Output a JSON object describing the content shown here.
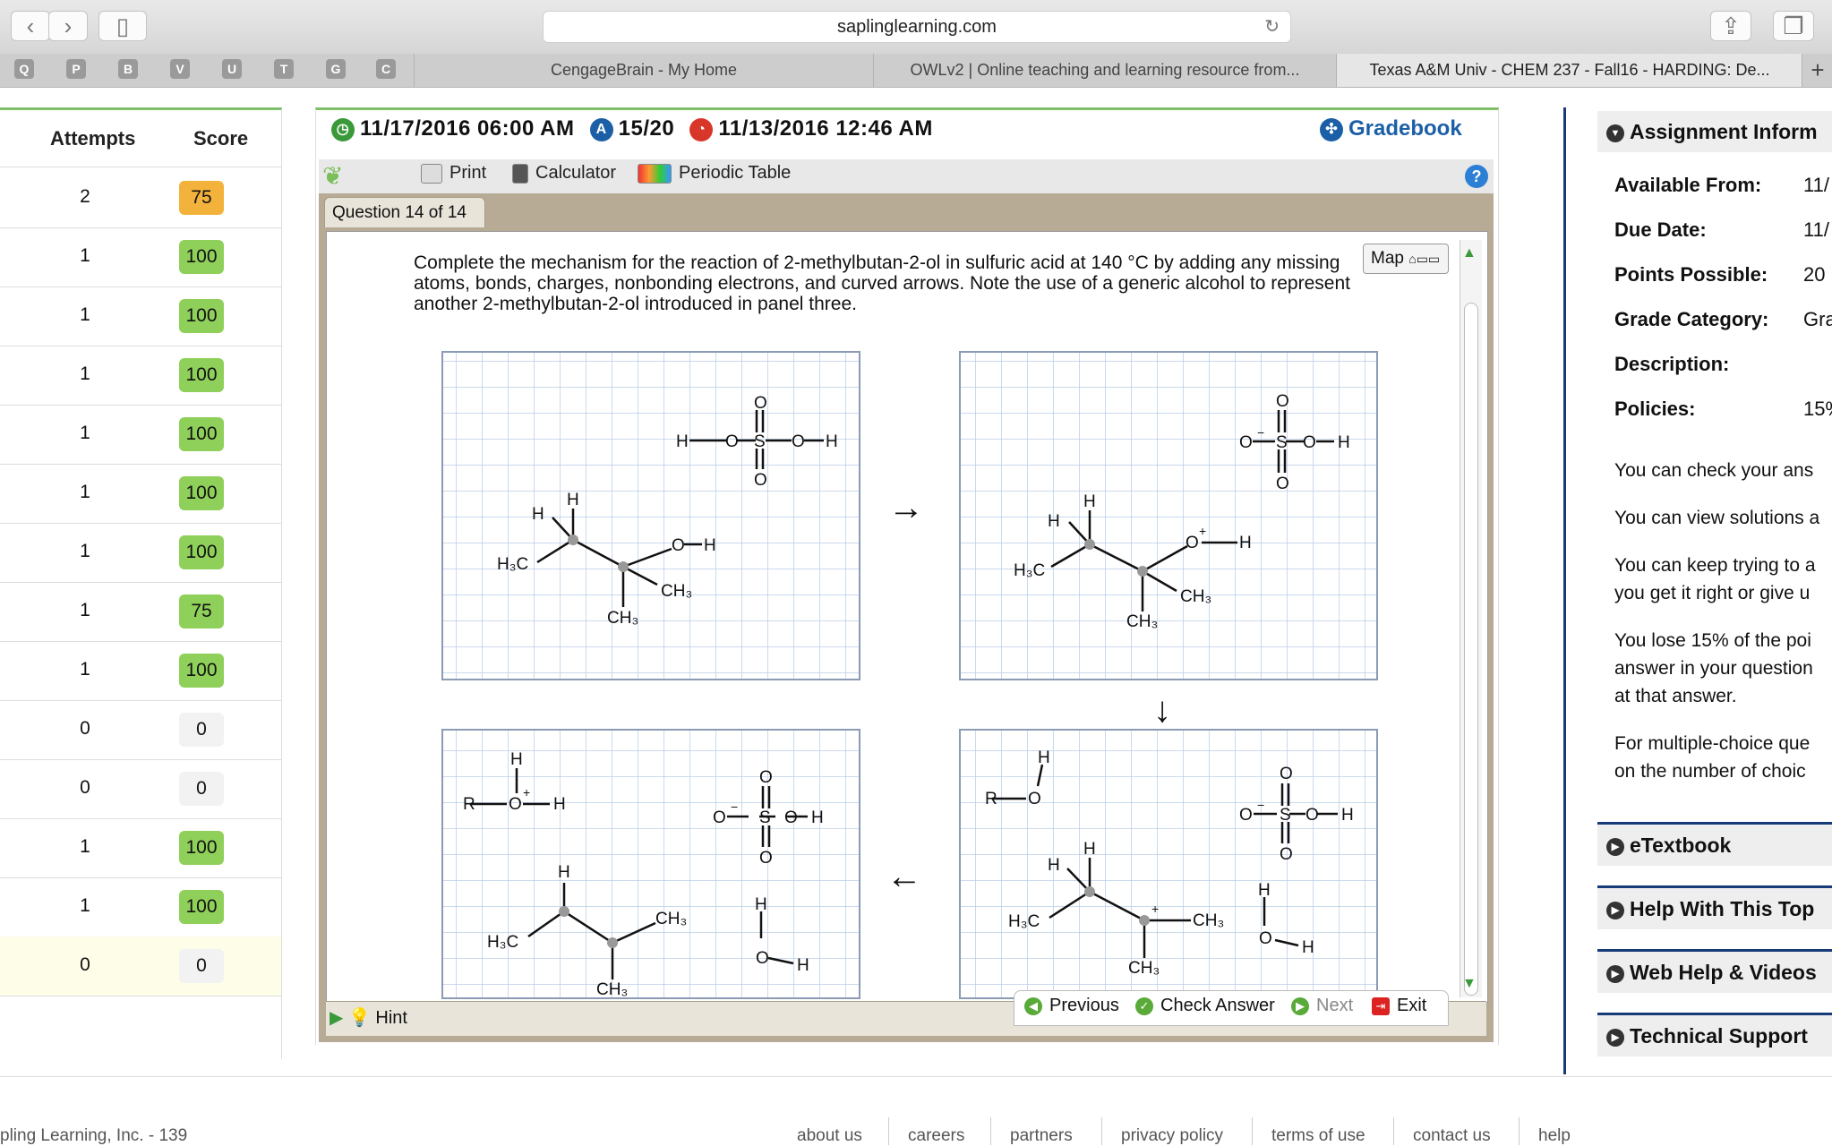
{
  "browser": {
    "url": "saplinglearning.com",
    "bookmarks": [
      "Q",
      "P",
      "B",
      "V",
      "U",
      "T",
      "G",
      "C"
    ],
    "tabs": [
      {
        "label": "CengageBrain - My Home"
      },
      {
        "label": "OWLv2 | Online teaching and learning resource from..."
      },
      {
        "label": "Texas A&M Univ - CHEM 237 - Fall16 - HARDING: De..."
      }
    ],
    "new_tab": "+"
  },
  "scores": {
    "headers": {
      "attempts": "Attempts",
      "score": "Score"
    },
    "rows": [
      {
        "attempts": "2",
        "score": "75",
        "color": "#f3b23b"
      },
      {
        "attempts": "1",
        "score": "100",
        "color": "#8fd05a"
      },
      {
        "attempts": "1",
        "score": "100",
        "color": "#8fd05a"
      },
      {
        "attempts": "1",
        "score": "100",
        "color": "#8fd05a"
      },
      {
        "attempts": "1",
        "score": "100",
        "color": "#8fd05a"
      },
      {
        "attempts": "1",
        "score": "100",
        "color": "#8fd05a"
      },
      {
        "attempts": "1",
        "score": "100",
        "color": "#8fd05a"
      },
      {
        "attempts": "1",
        "score": "75",
        "color": "#8fd05a"
      },
      {
        "attempts": "1",
        "score": "100",
        "color": "#8fd05a"
      },
      {
        "attempts": "0",
        "score": "0",
        "color": "#f2f2f2"
      },
      {
        "attempts": "0",
        "score": "0",
        "color": "#f2f2f2"
      },
      {
        "attempts": "1",
        "score": "100",
        "color": "#8fd05a"
      },
      {
        "attempts": "1",
        "score": "100",
        "color": "#8fd05a"
      },
      {
        "attempts": "0",
        "score": "0",
        "color": "#f2f2f2"
      }
    ]
  },
  "status": {
    "due": "11/17/2016 06:00 AM",
    "points": "15/20",
    "time": "11/13/2016 12:46 AM",
    "gradebook": "Gradebook"
  },
  "toolbar": {
    "print": "Print",
    "calculator": "Calculator",
    "periodic_table": "Periodic Table",
    "help": "?"
  },
  "question": {
    "tab": "Question 14 of 14",
    "text": "Complete the mechanism for the reaction of 2-methylbutan-2-ol in sulfuric acid at 140 °C by adding any missing atoms, bonds, charges, nonbonding electrons, and curved arrows. Note the use of a generic alcohol to represent another 2-methylbutan-2-ol introduced in panel three.",
    "map": "Map",
    "hint": "Hint",
    "nav": {
      "previous": "Previous",
      "check": "Check Answer",
      "next": "Next",
      "exit": "Exit"
    },
    "arrows": {
      "right": "→",
      "down": "↓",
      "left": "←"
    },
    "atoms": {
      "H": "H",
      "O": "O",
      "S": "S",
      "R": "R",
      "H3C": "H₃C",
      "CH3": "CH₃",
      "plus": "+",
      "minus": "−"
    }
  },
  "sidebar": {
    "title": "Assignment Inform",
    "info": [
      {
        "label": "Available From:",
        "value": "11/"
      },
      {
        "label": "Due Date:",
        "value": "11/"
      },
      {
        "label": "Points Possible:",
        "value": "20"
      },
      {
        "label": "Grade Category:",
        "value": "Gra"
      },
      {
        "label": "Description:",
        "value": ""
      },
      {
        "label": "Policies:",
        "value": "15%"
      }
    ],
    "paragraphs": [
      [
        "You can check your ans"
      ],
      [
        "You can view solutions a"
      ],
      [
        "You can keep trying to a",
        "you get it right or give u"
      ],
      [
        "You lose 15% of the poi",
        "answer in your question",
        "at that answer."
      ],
      [
        "For multiple-choice que",
        "on the number of choic"
      ]
    ],
    "sections": [
      "eTextbook",
      "Help With This Top",
      "Web Help & Videos",
      "Technical Support"
    ]
  },
  "footer": {
    "copyright": "pling Learning, Inc. - 139",
    "links": [
      "about us",
      "careers",
      "partners",
      "privacy policy",
      "terms of use",
      "contact us",
      "help"
    ]
  }
}
